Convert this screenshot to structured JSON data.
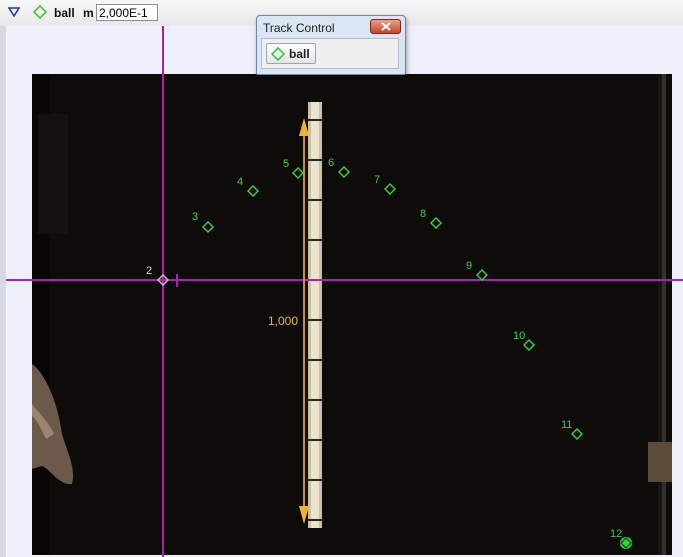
{
  "toolbar": {
    "track_name": "ball",
    "mass_label": "m",
    "mass_value": "2,000E-1",
    "icons": [
      "triangle-menu-icon",
      "diamond-track-icon"
    ]
  },
  "dialog": {
    "title": "Track Control",
    "track_button_label": "ball",
    "icons": [
      "close-icon",
      "diamond-track-icon"
    ]
  },
  "calibration": {
    "label": "1,000"
  },
  "trajectory": {
    "points": [
      {
        "label": "2",
        "selected": true
      },
      {
        "label": "3"
      },
      {
        "label": "4"
      },
      {
        "label": "5"
      },
      {
        "label": "6"
      },
      {
        "label": "7"
      },
      {
        "label": "8"
      },
      {
        "label": "9"
      },
      {
        "label": "10"
      },
      {
        "label": "11"
      },
      {
        "label": "12",
        "current": true
      }
    ]
  },
  "colors": {
    "marker": "#39d43c",
    "axes": "#b01fb0",
    "calibration": "#f2b233",
    "selected_marker": "#c8c8c8"
  }
}
